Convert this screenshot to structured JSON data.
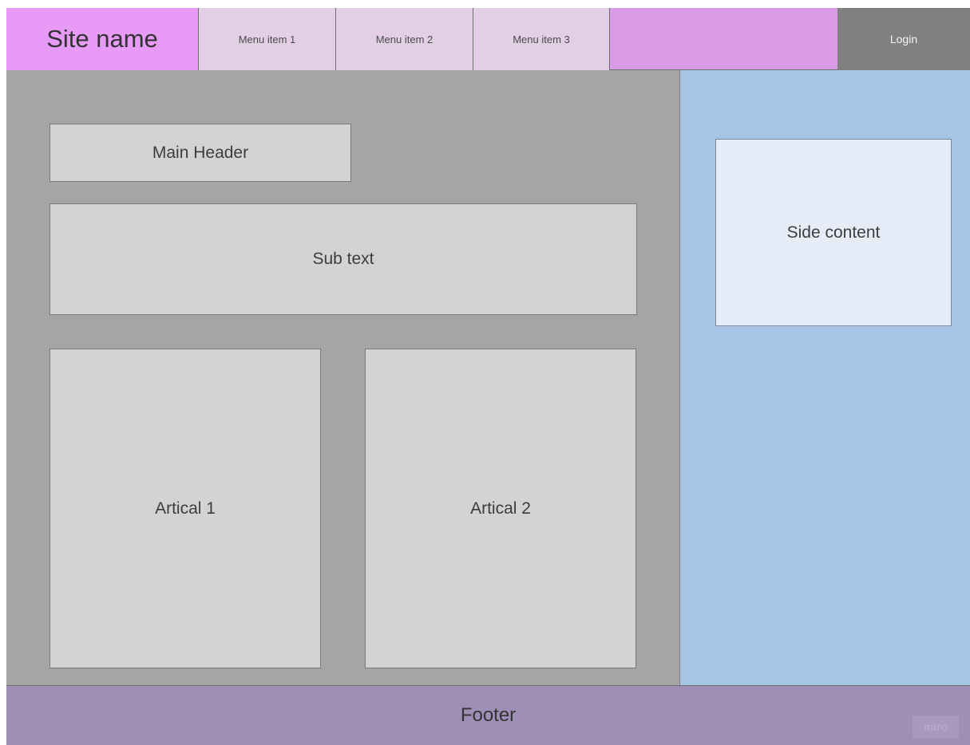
{
  "header": {
    "site_name": "Site name",
    "menu": [
      {
        "label": "Menu item 1"
      },
      {
        "label": "Menu item 2"
      },
      {
        "label": "Menu item 3"
      }
    ],
    "login_label": "Login"
  },
  "main": {
    "header": "Main Header",
    "subtext": "Sub text",
    "articles": [
      {
        "label": "Artical 1"
      },
      {
        "label": "Artical 2"
      }
    ]
  },
  "sidebar": {
    "content_label": "Side content"
  },
  "footer": {
    "label": "Footer"
  },
  "watermark": "miro",
  "colors": {
    "site_name_bg": "#e79af6",
    "menu_bg": "#e2cfe6",
    "topbar_bg": "#d99be6",
    "login_bg": "#808080",
    "main_bg": "#a5a5a5",
    "box_bg": "#d3d3d3",
    "sidebar_bg": "#a6c4e3",
    "side_content_bg": "#e6ecf7",
    "footer_bg": "#9f8fb7"
  }
}
